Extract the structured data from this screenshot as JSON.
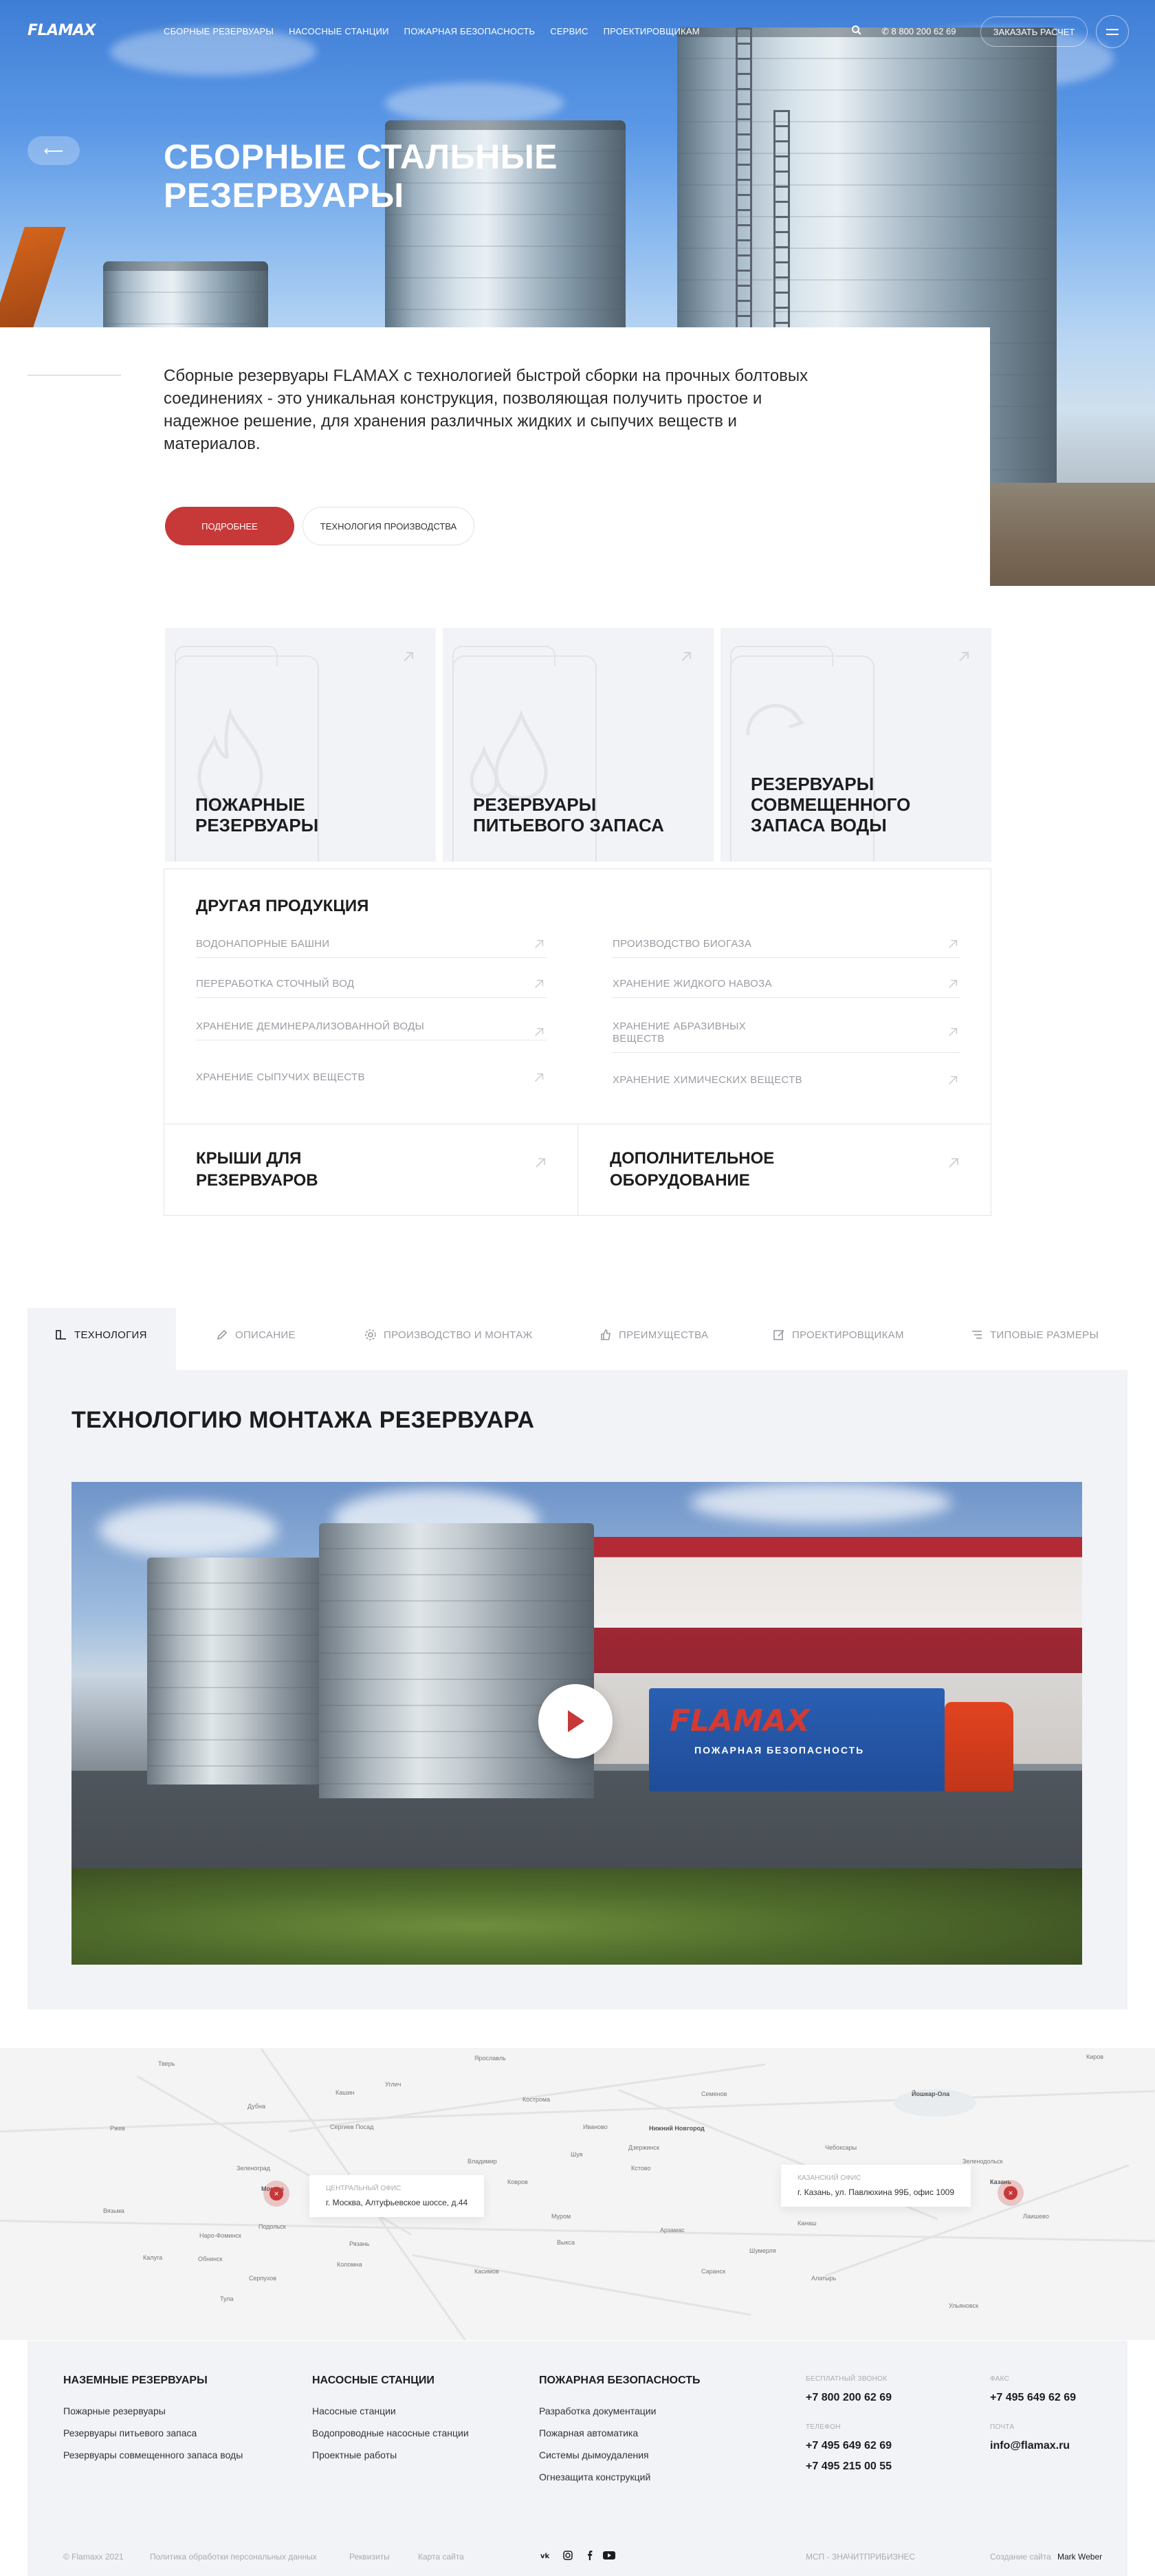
{
  "nav": {
    "logo": "FLAMAX",
    "links": [
      "СБОРНЫЕ РЕЗЕРВУАРЫ",
      "НАСОСНЫЕ СТАНЦИИ",
      "ПОЖАРНАЯ БЕЗОПАСНОСТЬ",
      "СЕРВИС",
      "ПРОЕКТИРОВЩИКАМ"
    ],
    "phone": "8 800 200 62 69",
    "cta": "ЗАКАЗАТЬ РАСЧЕТ"
  },
  "hero": {
    "title": "СБОРНЫЕ СТАЛЬНЫЕ РЕЗЕРВУАРЫ",
    "back_icon": "back-arrow-icon"
  },
  "intro": {
    "text": "Сборные резервуары FLAMAX с технологией быстрой сборки на прочных болтовых соединениях - это уникальная конструкция, позволяющая получить простое и надежное решение, для хранения различных жидких и сыпучих веществ и материалов.",
    "primary_button": "ПОДРОБНЕЕ",
    "secondary_button": "ТЕХНОЛОГИЯ ПРОИЗВОДСТВА"
  },
  "products": [
    {
      "title": "ПОЖАРНЫЕ РЕЗЕРВУАРЫ",
      "icon": "flame-icon"
    },
    {
      "title": "РЕЗЕРВУАРЫ ПИТЬЕВОГО ЗАПАСА",
      "icon": "water-drop-icon"
    },
    {
      "title": "РЕЗЕРВУАРЫ СОВМЕЩЕННОГО ЗАПАСА ВОДЫ",
      "icon": "cycle-icon"
    }
  ],
  "other": {
    "title": "ДРУГАЯ ПРОДУКЦИЯ",
    "left": [
      "ВОДОНАПОРНЫЕ БАШНИ",
      "ПЕРЕРАБОТКА СТОЧНЫЙ ВОД",
      "ХРАНЕНИЕ ДЕМИНЕРАЛИЗОВАННОЙ ВОДЫ",
      "ХРАНЕНИЕ СЫПУЧИХ ВЕЩЕСТВ"
    ],
    "right": [
      "ПРОИЗВОДСТВО БИОГАЗА",
      "ХРАНЕНИЕ ЖИДКОГО НАВОЗА",
      "ХРАНЕНИЕ АБРАЗИВНЫХ ВЕЩЕСТВ",
      "ХРАНЕНИЕ ХИМИЧЕСКИХ ВЕЩЕСТВ"
    ]
  },
  "extra_cards": [
    "КРЫШИ ДЛЯ РЕЗЕРВУАРОВ",
    "ДОПОЛНИТЕЛЬНОЕ ОБОРУДОВАНИЕ"
  ],
  "tabs": [
    {
      "label": "ТЕХНОЛОГИЯ",
      "icon": "tech-icon",
      "active": true
    },
    {
      "label": "ОПИСАНИЕ",
      "icon": "pencil-icon",
      "active": false
    },
    {
      "label": "ПРОИЗВОДСТВО И МОНТАЖ",
      "icon": "gear-icon",
      "active": false
    },
    {
      "label": "ПРЕИМУЩЕСТВА",
      "icon": "thumb-up-icon",
      "active": false
    },
    {
      "label": "ПРОЕКТИРОВЩИКАМ",
      "icon": "edit-icon",
      "active": false
    },
    {
      "label": "ТИПОВЫЕ РАЗМЕРЫ",
      "icon": "sliders-icon",
      "active": false
    }
  ],
  "technology": {
    "title": "ТЕХНОЛОГИЮ МОНТАЖА РЕЗЕРВУАРА",
    "video_truck_logo": "FLAMAX",
    "video_truck_sub": "ПОЖАРНАЯ БЕЗОПАСНОСТЬ"
  },
  "map": {
    "offices": [
      {
        "label": "ЦЕНТРАЛЬНЫЙ ОФИС",
        "address": "г. Москва, Алтуфьевское шоссе, д.44"
      },
      {
        "label": "КАЗАНСКИЙ ОФИС",
        "address": "г. Казань, ул. Павлюхина 99Б, офис 1009"
      }
    ],
    "cities": [
      "Тверь",
      "Кашин",
      "Углич",
      "Ярославль",
      "Кострома",
      "Иваново",
      "Владимир",
      "Муром",
      "Нижний Новгород",
      "Чебоксары",
      "Йошкар-Ола",
      "Казань",
      "Рязань",
      "Тула",
      "Калуга",
      "Москва",
      "Подольск",
      "Коломна",
      "Кстово",
      "Арзамас",
      "Саранск",
      "Ульяновск",
      "Дзержинск",
      "Шуя",
      "Зеленоград",
      "Наро-Фоминск",
      "Обнинск",
      "Серпухов",
      "Сергиев Посад",
      "Дубна",
      "Ржев",
      "Вязьма",
      "Ковров",
      "Выкса",
      "Касимов",
      "Семенов",
      "Киров",
      "Лаишево",
      "Зеленодольск",
      "Канаш",
      "Алатырь",
      "Шумерля"
    ]
  },
  "footer": {
    "col1": {
      "title": "НАЗЕМНЫЕ РЕЗЕРВУАРЫ",
      "links": [
        "Пожарные резервуары",
        "Резервуары питьевого запаса",
        "Резервуары совмещенного запаса воды"
      ]
    },
    "col2": {
      "title": "НАСОСНЫЕ СТАНЦИИ",
      "links": [
        "Насосные станции",
        "Водопроводные насосные станции",
        "Проектные работы"
      ]
    },
    "col3": {
      "title": "ПОЖАРНАЯ БЕЗОПАСНОСТЬ",
      "links": [
        "Разработка документации",
        "Пожарная автоматика",
        "Системы дымоудаления",
        "Огнезащита конструкций"
      ]
    },
    "free_call_label": "БЕСПЛАТНЫЙ ЗВОНОК",
    "free_call": "+7 800 200 62 69",
    "phone_label": "ТЕЛЕФОН",
    "phones": [
      "+7 495 649 62 69",
      "+7 495 215 00 55"
    ],
    "fax_label": "ФАКС",
    "fax": "+7 495 649 62 69",
    "mail_label": "ПОЧТА",
    "mail": "info@flamax.ru",
    "copyright": "© Flamaxx 2021",
    "policy": "Политика обработки персональных данных",
    "requisites": "Реквизиты",
    "sitemap": "Карта сайта",
    "sme": "МСП - ЗНАЧИТПРИБИЗНЕС",
    "created_by_label": "Создание сайта",
    "created_by": "Mark Weber",
    "socials": [
      "vk-icon",
      "instagram-icon",
      "facebook-icon",
      "youtube-icon"
    ]
  },
  "colors": {
    "accent": "#c73838",
    "panel": "#f2f3f6",
    "text": "#1d1d1f",
    "muted": "#9a9ca3"
  }
}
